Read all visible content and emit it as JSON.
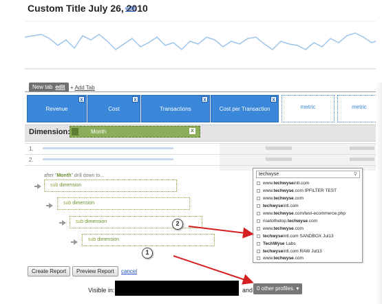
{
  "report": {
    "title": "Custom Title July 26, 2010",
    "edit_link": "edit"
  },
  "tabs": {
    "active_tab": "New tab",
    "active_tab_edit": "edit",
    "add_tab": "+ Add Tab",
    "add_tab_prefix": "+ ",
    "add_tab_label": "Add Tab"
  },
  "metrics": [
    {
      "label": "Revenue",
      "remove": "x"
    },
    {
      "label": "Cost",
      "remove": "x"
    },
    {
      "label": "Transactions",
      "remove": "x"
    },
    {
      "label": "Cost per Transaction",
      "remove": "x"
    }
  ],
  "metric_placeholders": [
    "metric",
    "metric"
  ],
  "dimension": {
    "label": "Dimension:",
    "value": "Month",
    "remove": "x"
  },
  "rows": [
    "1.",
    "2."
  ],
  "drilldown": {
    "after_prefix": "after \"",
    "after_value": "Month",
    "after_suffix": "\" drill down to...",
    "sub_prefix": "sub",
    "sub_suffix": "dimension"
  },
  "profile_search": {
    "value": "techwyse",
    "search_icon": "magnifier-icon",
    "items": [
      {
        "pre": "www.",
        "bold": "techwyse",
        "post": "intl.com"
      },
      {
        "pre": "www.",
        "bold": "techwyse",
        "post": ".com IPFILTER TEST"
      },
      {
        "pre": "www.",
        "bold": "techwyse",
        "post": ".com"
      },
      {
        "pre": "",
        "bold": "techwyse",
        "post": "intl.com"
      },
      {
        "pre": "www.",
        "bold": "techwyse",
        "post": ".com/test-ecommerce.php"
      },
      {
        "pre": "risetothetop.",
        "bold": "techwyse",
        "post": ".com"
      },
      {
        "pre": "www.",
        "bold": "techwyse",
        "post": ".com"
      },
      {
        "pre": "",
        "bold": "techwyse",
        "post": "intl.com SANDBOX Jul13"
      },
      {
        "pre": "",
        "bold": "TechWyse",
        "post": " Labs"
      },
      {
        "pre": "",
        "bold": "techwyse",
        "post": "intl.com RAW Jul13"
      },
      {
        "pre": "www.",
        "bold": "techwyse",
        "post": ".com"
      }
    ]
  },
  "markers": [
    "1",
    "2"
  ],
  "buttons": {
    "create": "Create Report",
    "preview": "Preview Report",
    "cancel": "cancel"
  },
  "visibility": {
    "visible_in": "Visible in:",
    "and": "and",
    "profiles": "0 other profiles.",
    "profiles_arrow": "▾"
  },
  "colors": {
    "metric_blue": "#3a86d8",
    "dimension_green": "#8cad5a",
    "annotation_red": "#d42020",
    "link_blue": "#2255cc"
  }
}
